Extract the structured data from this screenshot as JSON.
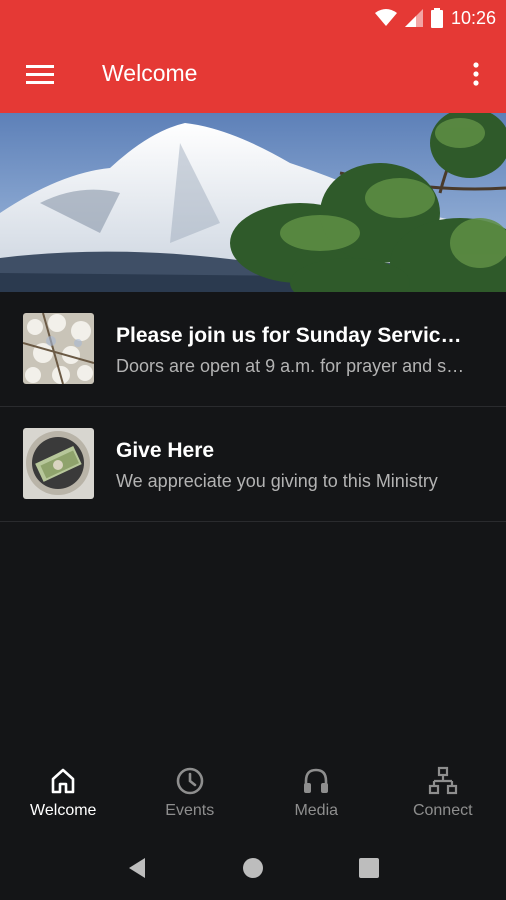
{
  "status_bar": {
    "time": "10:26"
  },
  "app_bar": {
    "title": "Welcome"
  },
  "feed": [
    {
      "title": "Please join us for Sunday Servic…",
      "subtitle": "Doors are open at 9 a.m. for prayer and s…"
    },
    {
      "title": "Give Here",
      "subtitle": "We appreciate you giving to this Ministry"
    }
  ],
  "bottom_nav": {
    "tabs": [
      {
        "label": "Welcome",
        "icon": "home-icon",
        "active": true
      },
      {
        "label": "Events",
        "icon": "clock-icon",
        "active": false
      },
      {
        "label": "Media",
        "icon": "headphones-icon",
        "active": false
      },
      {
        "label": "Connect",
        "icon": "sitemap-icon",
        "active": false
      }
    ]
  },
  "colors": {
    "accent": "#e53935",
    "background": "#141517",
    "inactive": "#8e8e8e"
  }
}
